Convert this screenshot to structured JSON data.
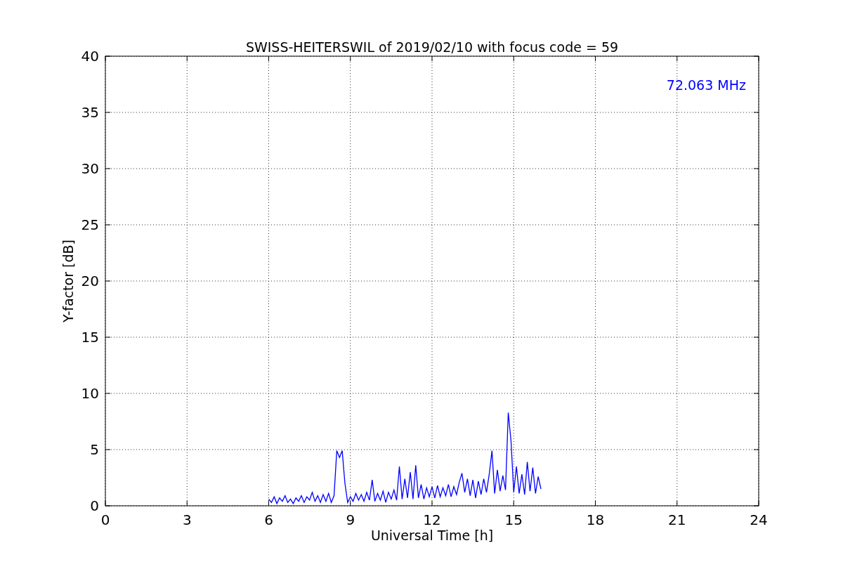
{
  "chart_data": {
    "type": "line",
    "title": "SWISS-HEITERSWIL of 2019/02/10 with focus code = 59",
    "xlabel": "Universal Time [h]",
    "ylabel": "Y-factor [dB]",
    "x": [
      6.0,
      6.1,
      6.2,
      6.3,
      6.4,
      6.5,
      6.6,
      6.7,
      6.8,
      6.9,
      7.0,
      7.1,
      7.2,
      7.3,
      7.4,
      7.5,
      7.6,
      7.7,
      7.8,
      7.9,
      8.0,
      8.1,
      8.2,
      8.3,
      8.4,
      8.5,
      8.6,
      8.7,
      8.8,
      8.9,
      9.0,
      9.1,
      9.2,
      9.3,
      9.4,
      9.5,
      9.6,
      9.7,
      9.8,
      9.9,
      10.0,
      10.1,
      10.2,
      10.3,
      10.4,
      10.5,
      10.6,
      10.7,
      10.8,
      10.9,
      11.0,
      11.1,
      11.2,
      11.3,
      11.4,
      11.5,
      11.6,
      11.7,
      11.8,
      11.9,
      12.0,
      12.1,
      12.2,
      12.3,
      12.4,
      12.5,
      12.6,
      12.7,
      12.8,
      12.9,
      13.0,
      13.1,
      13.2,
      13.3,
      13.4,
      13.5,
      13.6,
      13.7,
      13.8,
      13.9,
      14.0,
      14.1,
      14.2,
      14.3,
      14.4,
      14.5,
      14.6,
      14.7,
      14.8,
      14.9,
      15.0,
      15.1,
      15.2,
      15.3,
      15.4,
      15.5,
      15.6,
      15.7,
      15.8,
      15.9,
      16.0
    ],
    "series": [
      {
        "name": "72.063 MHz",
        "color": "#0000ff",
        "values": [
          0.6,
          0.3,
          0.8,
          0.2,
          0.7,
          0.4,
          0.9,
          0.3,
          0.6,
          0.2,
          0.7,
          0.4,
          0.9,
          0.3,
          0.8,
          0.5,
          1.2,
          0.4,
          0.9,
          0.3,
          1.0,
          0.4,
          1.1,
          0.3,
          0.9,
          4.9,
          4.3,
          4.9,
          2.0,
          0.3,
          0.8,
          0.4,
          1.1,
          0.5,
          1.0,
          0.4,
          1.2,
          0.5,
          2.3,
          0.4,
          1.1,
          0.5,
          1.3,
          0.3,
          1.2,
          0.6,
          1.4,
          0.5,
          3.5,
          0.6,
          2.4,
          0.7,
          3.0,
          0.6,
          3.6,
          0.7,
          1.9,
          0.6,
          1.6,
          0.8,
          1.7,
          0.7,
          1.8,
          0.8,
          1.6,
          0.9,
          1.9,
          0.8,
          1.7,
          1.0,
          2.1,
          2.9,
          1.2,
          2.4,
          0.9,
          2.3,
          0.7,
          2.2,
          1.0,
          2.4,
          1.2,
          2.8,
          4.9,
          1.1,
          3.2,
          1.3,
          2.7,
          1.4,
          8.3,
          5.8,
          1.2,
          3.5,
          1.1,
          2.8,
          1.0,
          3.9,
          1.3,
          3.4,
          1.1,
          2.6,
          1.5
        ]
      }
    ],
    "xlim": [
      0,
      24
    ],
    "ylim": [
      0,
      40
    ],
    "xticks": [
      0,
      3,
      6,
      9,
      12,
      15,
      18,
      21,
      24
    ],
    "yticks": [
      0,
      5,
      10,
      15,
      20,
      25,
      30,
      35,
      40
    ],
    "grid": true
  }
}
